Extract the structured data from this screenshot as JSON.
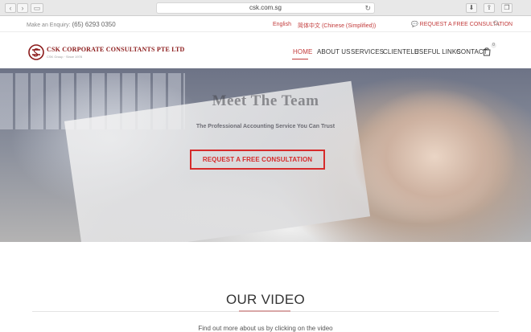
{
  "browser": {
    "url": "csk.com.sg"
  },
  "topbar": {
    "enquiry_label": "Make an Enquiry:",
    "phone": "(65) 6293 0350",
    "lang_en": "English",
    "lang_zh": "简体中文 (Chinese (Simplified))",
    "consult_link": "REQUEST A FREE CONSULTATION"
  },
  "header": {
    "logo_name": "CSK CORPORATE CONSULTANTS PTE LTD",
    "logo_tagline": "CSK Group · Since 1978",
    "menu": [
      {
        "label": "HOME",
        "active": true
      },
      {
        "label": "ABOUT US",
        "active": false
      },
      {
        "label": "SERVICES",
        "active": false
      },
      {
        "label": "CLIENTELE",
        "active": false
      },
      {
        "label": "USEFUL LINKS",
        "active": false
      },
      {
        "label": "CONTACT",
        "active": false
      }
    ],
    "cart_count": "0"
  },
  "hero": {
    "title": "Meet The Team",
    "subtitle": "The Professional Accounting Service You Can Trust",
    "cta": "REQUEST A FREE CONSULTATION"
  },
  "section": {
    "title": "OUR VIDEO",
    "text": "Find out more about us by clicking on the video"
  },
  "colors": {
    "accent": "#c23a3a",
    "cta": "#d62b2b",
    "brand": "#8b1a1a"
  }
}
